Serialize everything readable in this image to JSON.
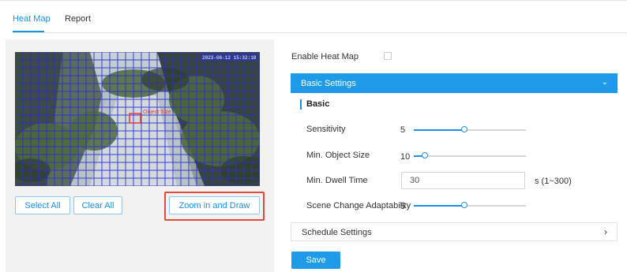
{
  "tabs": [
    {
      "label": "Heat Map",
      "active": true
    },
    {
      "label": "Report",
      "active": false
    }
  ],
  "preview": {
    "overlay_label": "Object Size",
    "timestamp_text": "2023-06-12 15:32:18",
    "grid_color": "#2a2fd8"
  },
  "buttons": {
    "select_all": "Select All",
    "clear_all": "Clear All",
    "zoom_draw": "Zoom in and Draw",
    "save": "Save"
  },
  "settings": {
    "enable_label": "Enable Heat Map",
    "enable_checked": false,
    "basic_settings": "Basic Settings",
    "basic_head": "Basic",
    "sensitivity": {
      "label": "Sensitivity",
      "value": "5",
      "fraction": 0.5
    },
    "min_object_size": {
      "label": "Min. Object Size",
      "value": "10",
      "fraction": 0.1
    },
    "min_dwell_time": {
      "label": "Min. Dwell Time",
      "value": "30",
      "unit": "s (1~300)"
    },
    "scene_change": {
      "label": "Scene Change Adaptability",
      "value": "5",
      "fraction": 0.5
    },
    "schedule_settings": "Schedule Settings"
  },
  "icons": {
    "collapse": "chevron-down-icon",
    "expand": "chevron-right-icon"
  },
  "colors": {
    "accent": "#1e9ae8",
    "highlight": "#e14b3b"
  }
}
